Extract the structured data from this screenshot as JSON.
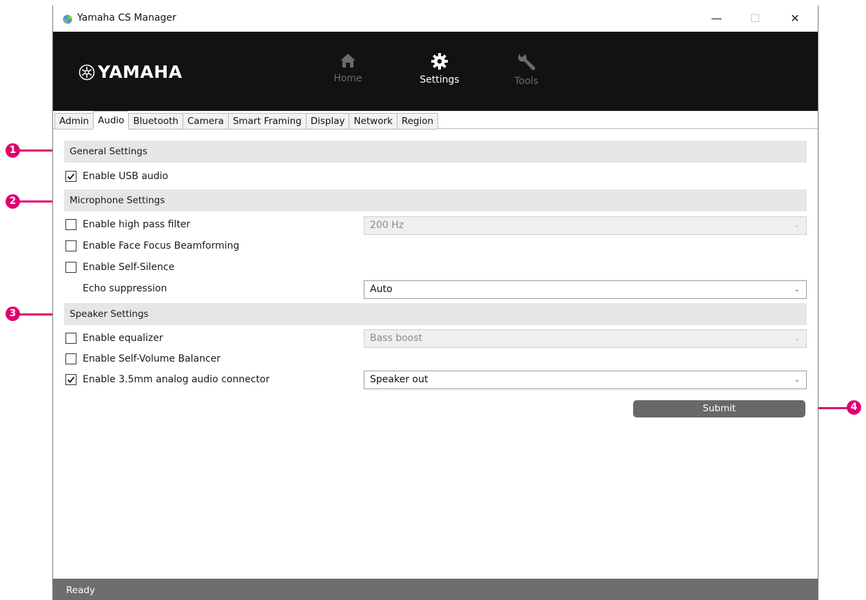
{
  "window": {
    "title": "Yamaha CS Manager",
    "min_glyph": "—",
    "max_glyph": "☐",
    "close_glyph": "✕"
  },
  "header": {
    "logo_text": "YAMAHA",
    "nav": [
      {
        "label": "Home",
        "icon": "home-icon",
        "active": false
      },
      {
        "label": "Settings",
        "icon": "gear-icon",
        "active": true
      },
      {
        "label": "Tools",
        "icon": "wrench-icon",
        "active": false
      }
    ]
  },
  "tabs": [
    "Admin",
    "Audio",
    "Bluetooth",
    "Camera",
    "Smart Framing",
    "Display",
    "Network",
    "Region"
  ],
  "active_tab": "Audio",
  "general": {
    "title": "General Settings",
    "enable_usb_audio": {
      "label": "Enable USB audio",
      "checked": true
    }
  },
  "microphone": {
    "title": "Microphone Settings",
    "high_pass_filter": {
      "label": "Enable high pass filter",
      "checked": false,
      "value": "200 Hz"
    },
    "face_focus": {
      "label": "Enable Face Focus Beamforming",
      "checked": false
    },
    "self_silence": {
      "label": "Enable Self-Silence",
      "checked": false
    },
    "echo_suppression": {
      "label": "Echo suppression",
      "value": "Auto"
    }
  },
  "speaker": {
    "title": "Speaker Settings",
    "equalizer": {
      "label": "Enable equalizer",
      "checked": false,
      "value": "Bass boost"
    },
    "self_volume": {
      "label": "Enable Self-Volume Balancer",
      "checked": false
    },
    "analog_connector": {
      "label": "Enable 3.5mm analog audio connector",
      "checked": true,
      "value": "Speaker out"
    }
  },
  "submit_label": "Submit",
  "status": "Ready",
  "callouts": [
    "1",
    "2",
    "3",
    "4"
  ],
  "colors": {
    "callout": "#e0006f",
    "header_bg": "#121212",
    "statusbar_bg": "#6e6e6e",
    "section_bg": "#e6e6e6"
  }
}
